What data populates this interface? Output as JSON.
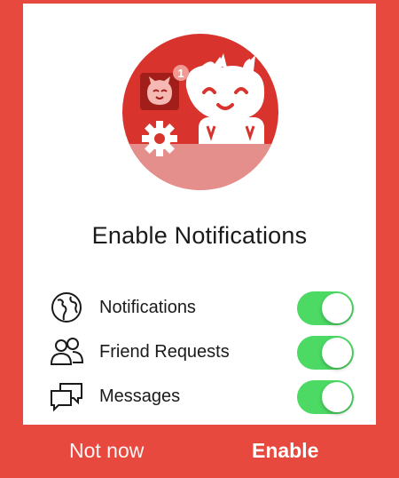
{
  "colors": {
    "brand_red": "#e8493f",
    "hero_red": "#d8332d",
    "toggle_green": "#4cd964"
  },
  "hero": {
    "badge_count": "1",
    "icons": [
      "app-mascot-icon",
      "small-mascot-icon",
      "gear-icon"
    ]
  },
  "title": "Enable Notifications",
  "settings": [
    {
      "icon": "globe-icon",
      "label": "Notifications",
      "enabled": true
    },
    {
      "icon": "friends-icon",
      "label": "Friend Requests",
      "enabled": true
    },
    {
      "icon": "messages-icon",
      "label": "Messages",
      "enabled": true
    }
  ],
  "footer": {
    "not_now_label": "Not now",
    "enable_label": "Enable"
  }
}
